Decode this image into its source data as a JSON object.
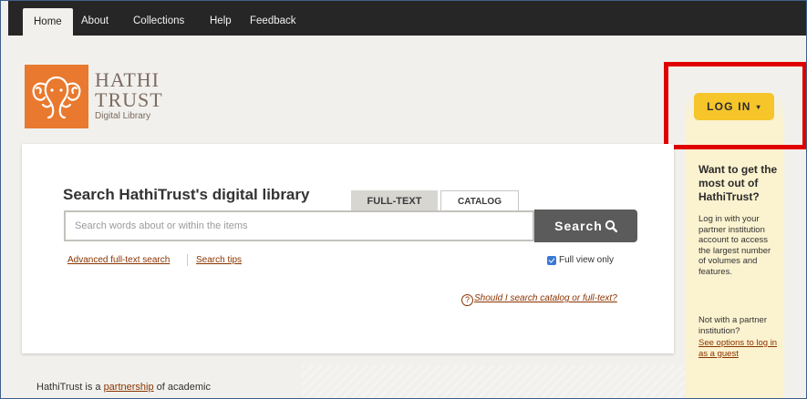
{
  "nav": {
    "tabs": [
      {
        "label": "Home"
      },
      {
        "label": "About"
      },
      {
        "label": "Collections"
      },
      {
        "label": "Help"
      },
      {
        "label": "Feedback"
      }
    ]
  },
  "logo": {
    "line1": "HATHI",
    "line2": "TRUST",
    "line3": "Digital Library",
    "icon": "elephant-icon"
  },
  "login": {
    "button_label": "LOG IN",
    "caret": "▾",
    "title": "Want to get the most out of HathiTrust?",
    "body": "Log in with your partner institution account to access the largest number of volumes and features.",
    "not_partner": "Not with a partner institution?",
    "guest_link": "See options to log in as a guest"
  },
  "search": {
    "title": "Search HathiTrust's digital library",
    "tab_fulltext": "FULL-TEXT",
    "tab_catalog": "CATALOG",
    "placeholder": "Search words about or within the items",
    "button_label": "Search",
    "advanced_link": "Advanced full-text search",
    "tips_link": "Search tips",
    "full_view_label": "Full view only",
    "full_view_checked": true,
    "help_link": "Should I search catalog or full-text?",
    "help_icon": "?"
  },
  "footer": {
    "prefix": "HathiTrust is a ",
    "link": "partnership",
    "suffix": " of academic"
  },
  "colors": {
    "accent_orange": "#e8792e",
    "login_yellow": "#f6c52a",
    "link_brown": "#8a3300",
    "highlight_red": "#e00000",
    "nav_dark": "#262626"
  }
}
